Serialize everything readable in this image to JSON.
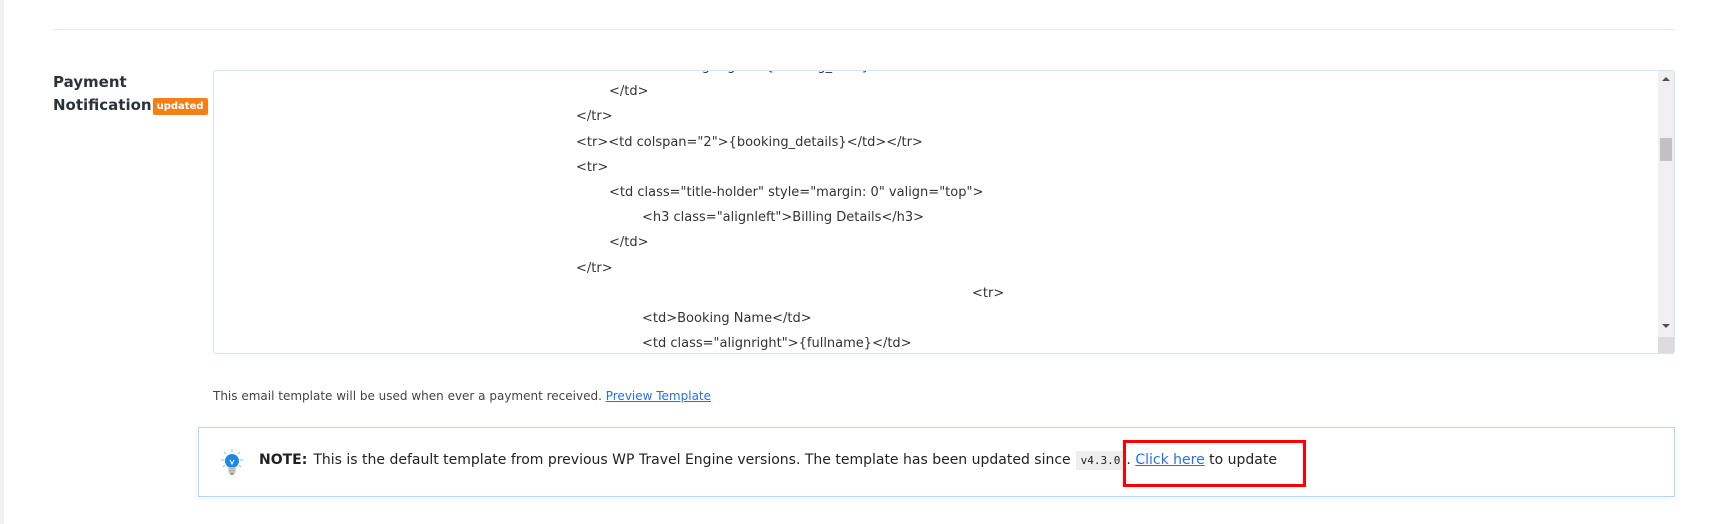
{
  "field": {
    "label_line1": "Payment",
    "label_line2": "Notification",
    "badge": "updated"
  },
  "template_code": {
    "lines": [
      {
        "indent": 1,
        "text": "<td class=\"alignright\">{booking_date}</td>"
      },
      {
        "indent": 1,
        "text": "</td>"
      },
      {
        "indent": 0,
        "text": "</tr>"
      },
      {
        "indent": 0,
        "text": "<tr><td colspan=\"2\">{booking_details}</td></tr>"
      },
      {
        "indent": 0,
        "text": "<tr>"
      },
      {
        "indent": 1,
        "text": "<td class=\"title-holder\" style=\"margin: 0\" valign=\"top\">"
      },
      {
        "indent": 2,
        "text": "<h3 class=\"alignleft\">Billing Details</h3>"
      },
      {
        "indent": 1,
        "text": "</td>"
      },
      {
        "indent": 0,
        "text": "</tr>"
      },
      {
        "indent": 12,
        "text": "<tr>"
      },
      {
        "indent": 2,
        "text": "<td>Booking Name</td>"
      },
      {
        "indent": 2,
        "text": "<td class=\"alignright\">{fullname}</td>"
      }
    ]
  },
  "help": {
    "text": "This email template will be used when ever a payment received.",
    "link": "Preview Template"
  },
  "note": {
    "icon": "lightbulb-icon",
    "label": "NOTE:",
    "text": "This is the default template from previous WP Travel Engine versions. The template has been updated since",
    "version": "v4.3.0",
    "period": ".",
    "link": "Click here",
    "suffix": "to update"
  },
  "colors": {
    "badge": "#f57f17",
    "link": "#2271f1",
    "highlight": "#ff0000",
    "note_border": "#b6d8f8"
  }
}
